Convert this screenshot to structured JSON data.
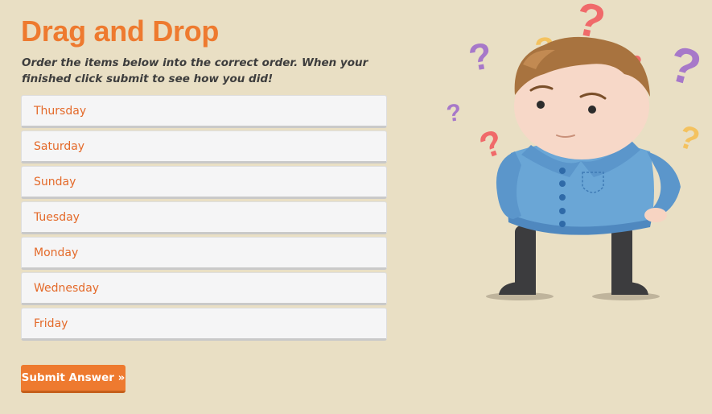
{
  "page": {
    "title": "Drag and Drop",
    "instructions": "Order the items below into the correct order. When your finished click submit to see how you did!"
  },
  "items": [
    {
      "label": "Thursday"
    },
    {
      "label": "Saturday"
    },
    {
      "label": "Sunday"
    },
    {
      "label": "Tuesday"
    },
    {
      "label": "Monday"
    },
    {
      "label": "Wednesday"
    },
    {
      "label": "Friday"
    }
  ],
  "submit": {
    "label": "Submit Answer »"
  },
  "illustration": {
    "subject": "confused-boy-illustration",
    "question_mark_glyph": "?"
  },
  "colors": {
    "background": "#e9dfc4",
    "accent": "#ee7a2f",
    "item_text": "#e46a2a",
    "shirt": "#6aa6d6",
    "hair": "#a8733f"
  }
}
